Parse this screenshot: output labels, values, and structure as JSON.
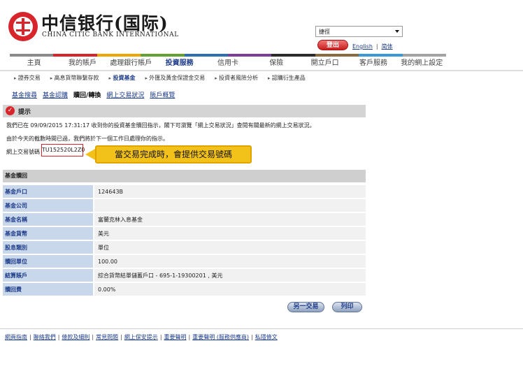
{
  "header": {
    "logo_cn": "中信银行(国际)",
    "logo_en": "CHINA CITIC BANK INTERNATIONAL",
    "search_select_value": "捷徑",
    "logout_label": "登出",
    "lang_english": "English",
    "lang_simplified": "简体"
  },
  "nav": {
    "colors": [
      "#8a8a8a",
      "#d8252b",
      "#f0a500",
      "#63a132",
      "#2e6fb4",
      "#7b3f98",
      "#2b2b2b",
      "#8a6b3f",
      "#3a9ad9",
      "#a3a3a3"
    ],
    "main": [
      "主頁",
      "我的賬戶",
      "處理銀行賬戶",
      "投資服務",
      "信用卡",
      "保險",
      "開立戶口",
      "客戶服務",
      "我的網上設定"
    ],
    "main_active_index": 3,
    "sub": [
      "證券交易",
      "高息貨幣聯繫存款",
      "投資基金",
      "外匯及黃金保證金交易",
      "投資者風險分析",
      "認購衍生產品"
    ],
    "tertiary": [
      "基金搜尋",
      "基金認購",
      "贖回/轉換",
      "網上交易狀況",
      "賬戶概覽"
    ]
  },
  "notice": {
    "title": "提示",
    "line1": "我們已在  09/09/2015 17:31:17 收到你的投資基金贖回指示，閣下可瀏覽「網上交易狀況」查閱有關最新的網上交易狀況。",
    "line2": "由於今天的截數時間已過，我們將於下一個工作日處理你的指示。",
    "ref_label": "網上交易號碼",
    "ref_number": "TU152520L2Z0",
    "callout": "當交易完成時，會提供交易號碼"
  },
  "fund": {
    "header": "基金贖回",
    "rows": [
      {
        "label": "基金戶口",
        "value": "124643B"
      },
      {
        "label": "基金公司",
        "value": ""
      },
      {
        "label": "基金名稱",
        "value": "富蘭克林入息基金"
      },
      {
        "label": "基金貨幣",
        "value": "美元"
      },
      {
        "label": "股息類別",
        "value": "單位"
      },
      {
        "label": "贖回單位",
        "value": "100.00"
      },
      {
        "label": "結算賬戶",
        "value": "綜合貨幣結單儲蓄戶口 - 695-1-19300201 , 美元"
      },
      {
        "label": "贖回費",
        "value": "0.00%"
      }
    ]
  },
  "actions": {
    "another": "另一交易",
    "print": "列印"
  },
  "footer": [
    "網頁指南",
    "聯絡我們",
    "條款及細則",
    "常見問題",
    "網上保安提示",
    "重要聲明",
    "重要聲明 (服務供應商)",
    "私隱條文"
  ]
}
